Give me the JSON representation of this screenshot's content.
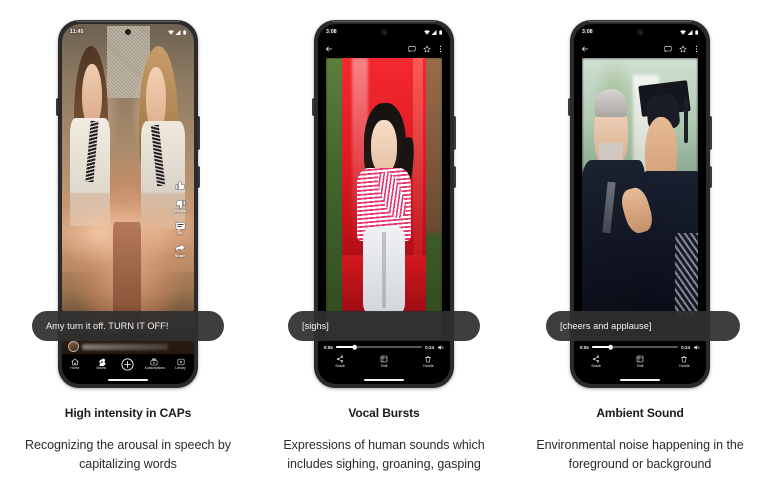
{
  "panels": [
    {
      "id": "high-intensity-caps",
      "app": "youtube-shorts",
      "status": {
        "time": "11:45",
        "wifi_icon": "wifi-icon",
        "signal_icon": "signal-icon",
        "battery_icon": "battery-icon"
      },
      "caption": "Amy turn it off. TURN IT OFF!",
      "action_rail": [
        {
          "icon": "thumb-up-icon",
          "label": ""
        },
        {
          "icon": "thumb-down-icon",
          "label": "Dislike"
        },
        {
          "icon": "comment-icon",
          "label": "2k"
        },
        {
          "icon": "share-arrow-icon",
          "label": "Share"
        }
      ],
      "bottom_nav": [
        {
          "icon": "home-icon",
          "label": "Home"
        },
        {
          "icon": "shorts-icon",
          "label": "Shorts"
        },
        {
          "icon": "plus-circle-icon",
          "label": ""
        },
        {
          "icon": "subscriptions-icon",
          "label": "Subscriptions"
        },
        {
          "icon": "library-icon",
          "label": "Library"
        }
      ],
      "title": "High intensity in CAPs",
      "description": "Recognizing the arousal in speech by capitalizing words"
    },
    {
      "id": "vocal-bursts",
      "app": "google-photos",
      "status": {
        "time": "3:08",
        "wifi_icon": "wifi-icon",
        "signal_icon": "signal-icon",
        "battery_icon": "battery-icon"
      },
      "topbar": {
        "back_icon": "back-arrow-icon",
        "cast_icon": "cast-icon",
        "star_icon": "star-icon",
        "more_icon": "more-vertical-icon"
      },
      "caption": "[sighs]",
      "player": {
        "current_time": "0:05",
        "total_time": "0:24",
        "progress_percent": 22,
        "volume_icon": "volume-icon"
      },
      "actions": [
        {
          "icon": "share-icon",
          "label": "Share"
        },
        {
          "icon": "edit-icon",
          "label": "Edit"
        },
        {
          "icon": "delete-icon",
          "label": "Delete"
        }
      ],
      "title": "Vocal Bursts",
      "description": "Expressions of human sounds which includes sighing, groaning, gasping"
    },
    {
      "id": "ambient-sound",
      "app": "google-photos",
      "status": {
        "time": "3:08",
        "wifi_icon": "wifi-icon",
        "signal_icon": "signal-icon",
        "battery_icon": "battery-icon"
      },
      "topbar": {
        "back_icon": "back-arrow-icon",
        "cast_icon": "cast-icon",
        "star_icon": "star-icon",
        "more_icon": "more-vertical-icon"
      },
      "caption": "[cheers and applause]",
      "player": {
        "current_time": "0:05",
        "total_time": "0:24",
        "progress_percent": 22,
        "volume_icon": "volume-icon"
      },
      "actions": [
        {
          "icon": "share-icon",
          "label": "Share"
        },
        {
          "icon": "edit-icon",
          "label": "Edit"
        },
        {
          "icon": "delete-icon",
          "label": "Delete"
        }
      ],
      "title": "Ambient Sound",
      "description": "Environmental noise happening in the foreground or background"
    }
  ],
  "colors": {
    "page_background": "#ffffff",
    "phone_frame": "#2b2b2d",
    "screen_background": "#000000",
    "caption_pill": "#2f2f2f",
    "caption_text": "#f3f3f3",
    "title_text": "#1a1a1a",
    "description_text": "#2b2b2b",
    "slide_red": "#e01a24",
    "gown_navy": "#1c2230"
  }
}
